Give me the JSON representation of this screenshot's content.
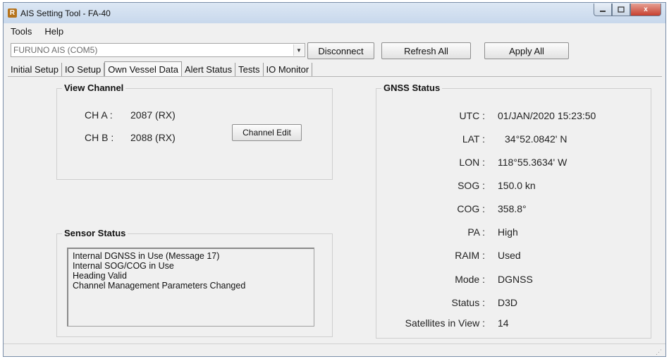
{
  "window": {
    "title": "AIS Setting Tool - FA-40",
    "app_icon": "R",
    "close_glyph": "x"
  },
  "menu": {
    "items": [
      "Tools",
      "Help"
    ]
  },
  "toolbar": {
    "port_value": "FURUNO AIS (COM5)",
    "disconnect_label": "Disconnect",
    "refresh_all_label": "Refresh All",
    "apply_all_label": "Apply All"
  },
  "tabs": [
    "Initial Setup",
    "IO Setup",
    "Own Vessel Data",
    "Alert Status",
    "Tests",
    "IO Monitor"
  ],
  "active_tab": "Own Vessel Data",
  "view_channel": {
    "title": "View Channel",
    "ch_a_label": "CH A :",
    "ch_a_value": "2087 (RX)",
    "ch_b_label": "CH B :",
    "ch_b_value": "2088 (RX)",
    "edit_button": "Channel Edit"
  },
  "sensor_status": {
    "title": "Sensor Status",
    "lines": [
      "Internal DGNSS in Use (Message 17)",
      "Internal SOG/COG in Use",
      "Heading Valid",
      "Channel Management Parameters Changed"
    ]
  },
  "gnss_status": {
    "title": "GNSS Status",
    "rows": [
      {
        "label": "UTC :",
        "value": "01/JAN/2020 15:23:50"
      },
      {
        "label": "LAT :",
        "value": "34°52.0842' N"
      },
      {
        "label": "LON :",
        "value": "118°55.3634' W"
      },
      {
        "label": "SOG :",
        "value": "150.0 kn"
      },
      {
        "label": "COG :",
        "value": "358.8°"
      },
      {
        "label": "PA :",
        "value": "High"
      },
      {
        "label": "RAIM :",
        "value": "Used"
      },
      {
        "label": "Mode :",
        "value": "DGNSS"
      },
      {
        "label": "Status :",
        "value": "D3D"
      },
      {
        "label": "Satellites in View :",
        "value": "14"
      }
    ]
  },
  "colors": {
    "title_bar": "#c8d8ec",
    "close_button": "#c7402f",
    "window_bg": "#f0f0f0"
  }
}
